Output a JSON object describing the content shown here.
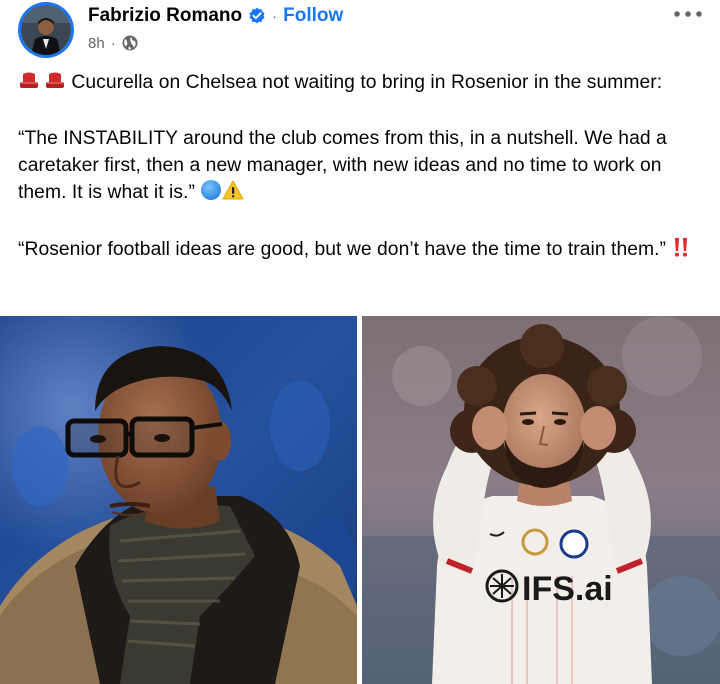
{
  "post": {
    "author": "Fabrizio Romano",
    "separator": "·",
    "follow_label": "Follow",
    "time": "8h",
    "meta_separator": "·",
    "text": {
      "line1": "Cucurella on Chelsea not waiting to bring in Rosenior in the summer:",
      "quote1": "“The INSTABILITY around the club comes from this, in a nutshell. We had a caretaker first, then a new manager, with new ideas and no time to work on them. It is what it is.”",
      "quote2": "“Rosenior football ideas are good, but we don’t have the time to train them.”"
    },
    "icons": {
      "verified": "verified-badge-icon",
      "privacy": "globe-icon",
      "more": "more-options-icon",
      "emojis": [
        "red-hat-icon",
        "red-hat-icon",
        "blue-circle-icon",
        "warning-icon",
        "double-exclamation-icon"
      ]
    },
    "colors": {
      "accent": "#1877f2",
      "secondary_text": "#65676b",
      "text": "#050505"
    },
    "photos": [
      {
        "label": "man-with-glasses-photo"
      },
      {
        "label": "player-in-white-kit-photo"
      }
    ],
    "sponsor_text": "IFS.ai"
  }
}
